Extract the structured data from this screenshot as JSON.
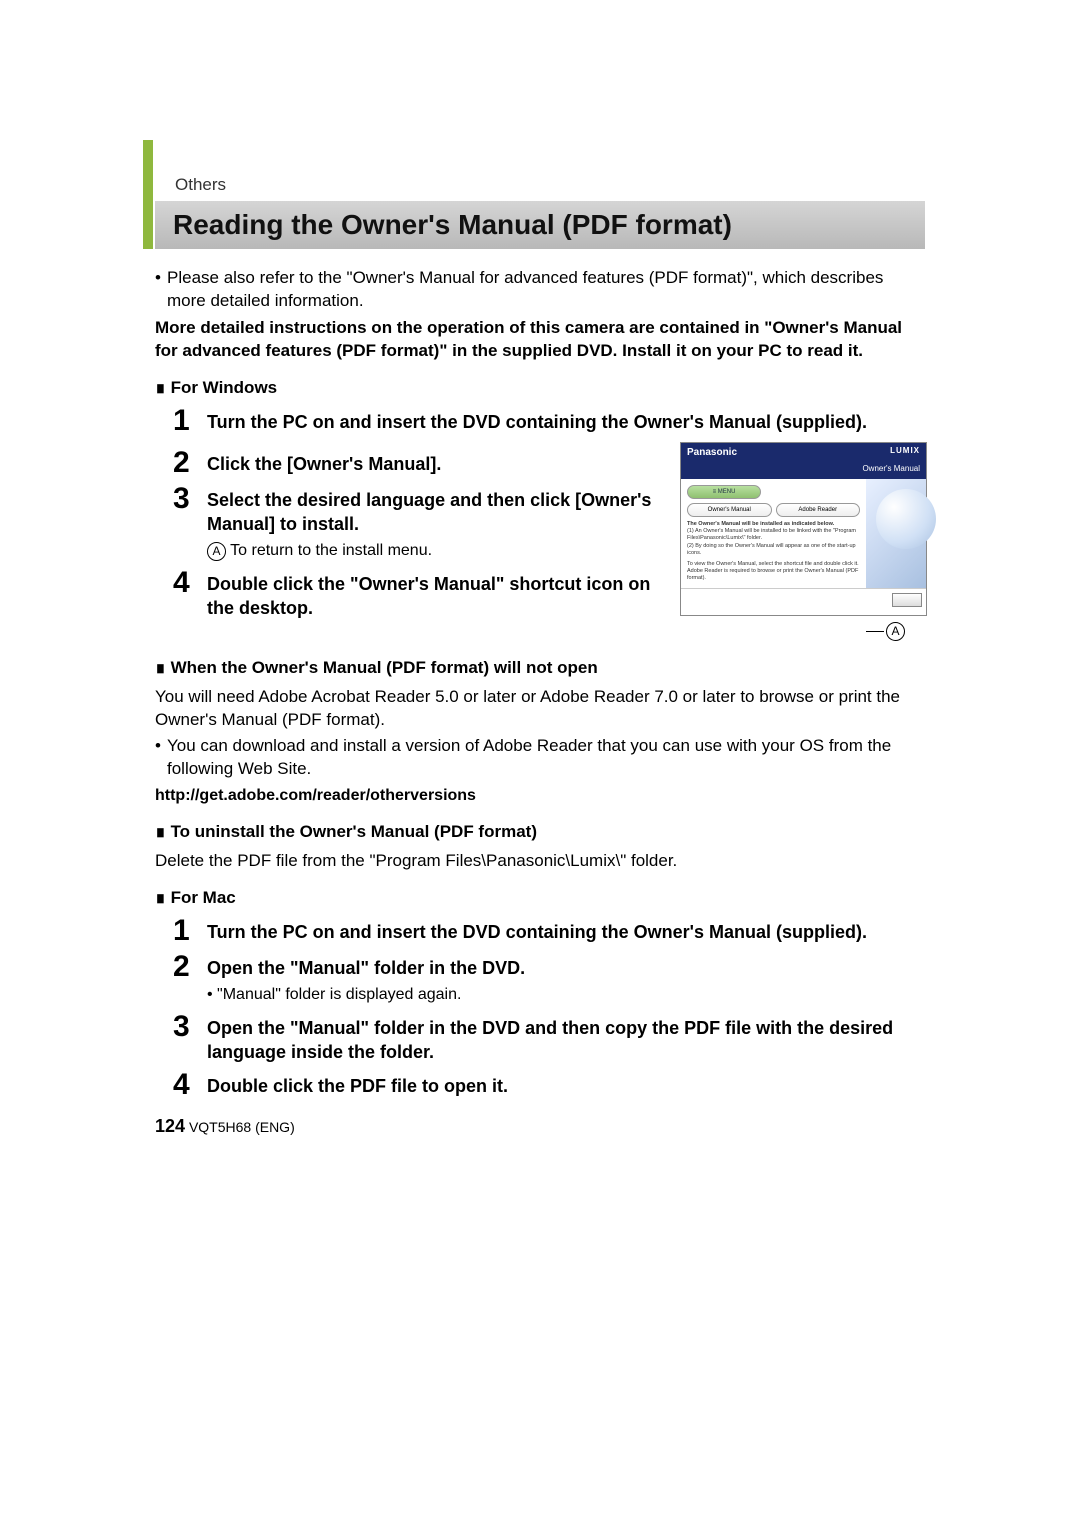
{
  "section": "Others",
  "title": "Reading the Owner's Manual (PDF format)",
  "intro_bullet": "Please also refer to the \"Owner's Manual for advanced features (PDF format)\", which describes more detailed information.",
  "intro_bold": "More detailed instructions on the operation of this camera are contained in \"Owner's Manual for advanced features (PDF format)\" in the supplied DVD. Install it on your PC to read it.",
  "windows": {
    "heading": "For Windows",
    "steps": [
      "Turn the PC on and insert the DVD containing the Owner's Manual (supplied).",
      "Click the [Owner's Manual].",
      "Select the desired language and then click [Owner's Manual] to install.",
      "Double click the \"Owner's Manual\" shortcut icon on the desktop."
    ],
    "step3_note_label": "A",
    "step3_note": "To return to the install menu."
  },
  "installer": {
    "brand": "Panasonic",
    "lumix": "LUMIX",
    "subtitle": "Owner's Manual",
    "menu_btn": "≡ MENU",
    "btn_owners": "Owner's Manual",
    "btn_adobe": "Adobe Reader",
    "heading": "The Owner's Manual will be installed as indicated below.",
    "line1": "(1) An Owner's Manual will be installed to be linked with the \"Program Files\\Panasonic\\Lumix\\\" folder.",
    "line2": "(2) By doing so the Owner's Manual will appear as one of the start-up icons.",
    "line3": "To view the Owner's Manual, select the shortcut file and double click it. Adobe Reader is required to browse or print the Owner's Manual (PDF format).",
    "callout": "A"
  },
  "not_open": {
    "heading": "When the Owner's Manual (PDF format) will not open",
    "text": "You will need Adobe Acrobat Reader 5.0 or later or Adobe Reader 7.0 or later to browse or print the Owner's Manual (PDF format).",
    "bullet": "You can download and install a version of Adobe Reader that you can use with your OS from the following Web Site.",
    "url": "http://get.adobe.com/reader/otherversions"
  },
  "uninstall": {
    "heading": "To uninstall the Owner's Manual (PDF format)",
    "text": "Delete the PDF file from the \"Program Files\\Panasonic\\Lumix\\\" folder."
  },
  "mac": {
    "heading": "For Mac",
    "steps": [
      "Turn the PC on and insert the DVD containing the Owner's Manual (supplied).",
      "Open the \"Manual\" folder in the DVD.",
      "Open the \"Manual\" folder in the DVD and then copy the PDF file with the desired language inside the folder.",
      "Double click the PDF file to open it."
    ],
    "step2_note": "\"Manual\" folder is displayed again."
  },
  "footer": {
    "page": "124",
    "code": "VQT5H68 (ENG)"
  }
}
